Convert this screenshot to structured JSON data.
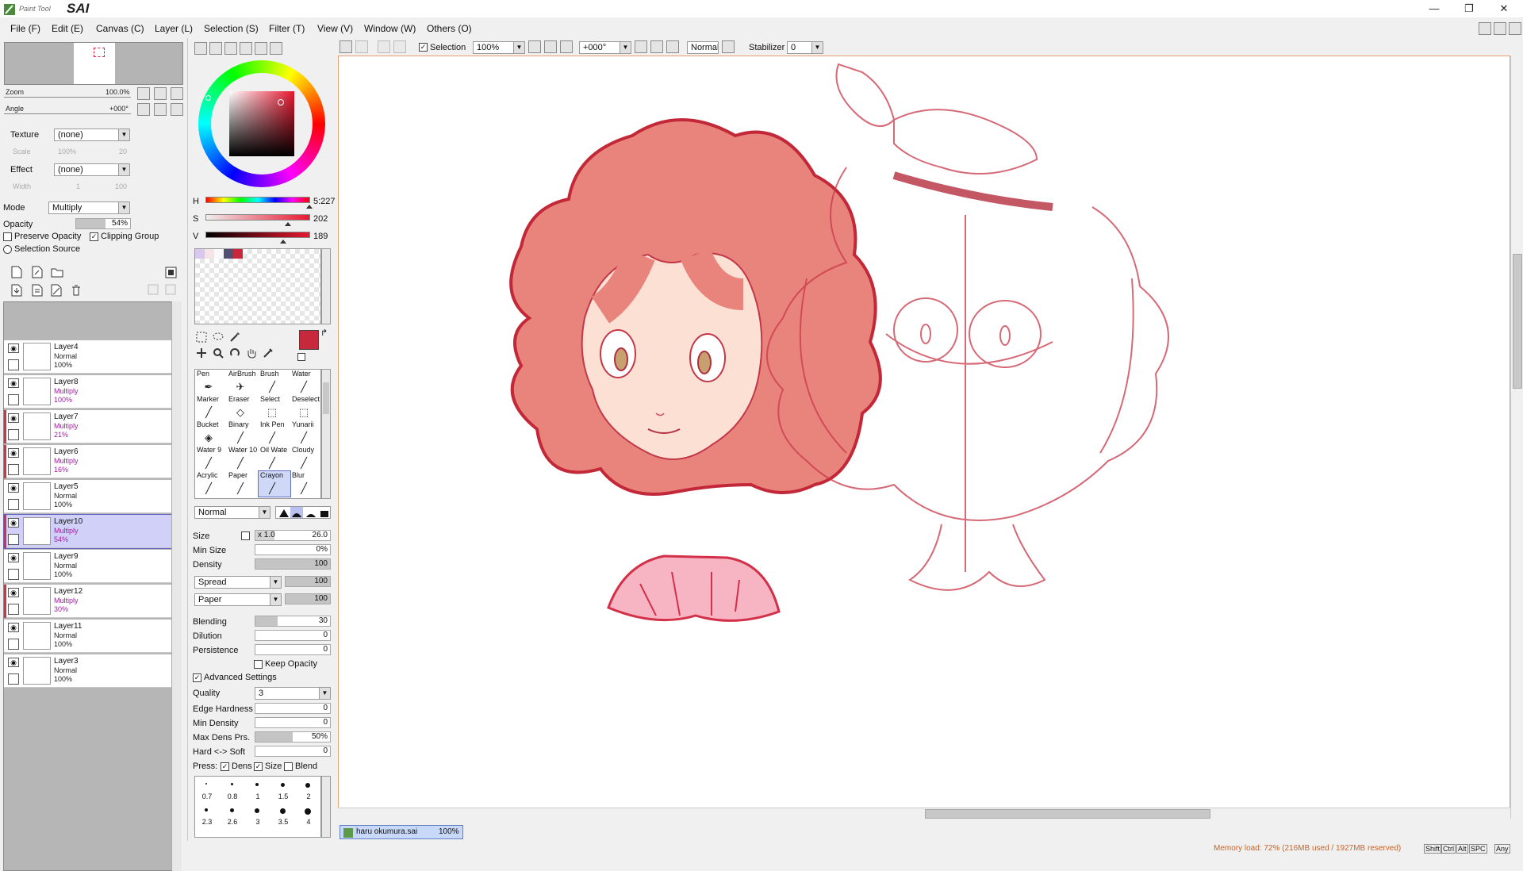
{
  "app": {
    "logo_small": "Paint Tool",
    "logo_big": "SAI"
  },
  "window_buttons": [
    "—",
    "❐",
    "✕"
  ],
  "menu": [
    "File (F)",
    "Edit (E)",
    "Canvas (C)",
    "Layer (L)",
    "Selection (S)",
    "Filter (T)",
    "View (V)",
    "Window (W)",
    "Others (O)"
  ],
  "navigator": {
    "zoom_label": "Zoom",
    "zoom_value": "100.0%",
    "angle_label": "Angle",
    "angle_value": "+000°"
  },
  "layer_props": {
    "texture_label": "Texture",
    "texture_value": "(none)",
    "scale_label": "Scale",
    "scale_value": "100%",
    "scale_num": "20",
    "effect_label": "Effect",
    "effect_value": "(none)",
    "width_label": "Width",
    "width_value": "1",
    "width_num": "100",
    "mode_label": "Mode",
    "mode_value": "Multiply",
    "opacity_label": "Opacity",
    "opacity_value": "54%",
    "opacity_fraction": 0.54,
    "preserve_opacity": "Preserve Opacity",
    "clipping_group": "Clipping Group",
    "selection_source": "Selection Source"
  },
  "layers": [
    {
      "name": "Layer4",
      "mode": "Normal",
      "opacity": "100%",
      "clip": false,
      "selected": false
    },
    {
      "name": "Layer8",
      "mode": "Multiply",
      "opacity": "100%",
      "clip": false,
      "selected": false
    },
    {
      "name": "Layer7",
      "mode": "Multiply",
      "opacity": "21%",
      "clip": true,
      "selected": false
    },
    {
      "name": "Layer6",
      "mode": "Multiply",
      "opacity": "16%",
      "clip": true,
      "selected": false
    },
    {
      "name": "Layer5",
      "mode": "Normal",
      "opacity": "100%",
      "clip": false,
      "selected": false
    },
    {
      "name": "Layer10",
      "mode": "Multiply",
      "opacity": "54%",
      "clip": true,
      "selected": true
    },
    {
      "name": "Layer9",
      "mode": "Normal",
      "opacity": "100%",
      "clip": false,
      "selected": false
    },
    {
      "name": "Layer12",
      "mode": "Multiply",
      "opacity": "30%",
      "clip": true,
      "selected": false
    },
    {
      "name": "Layer11",
      "mode": "Normal",
      "opacity": "100%",
      "clip": false,
      "selected": false
    },
    {
      "name": "Layer3",
      "mode": "Normal",
      "opacity": "100%",
      "clip": false,
      "selected": false
    }
  ],
  "color": {
    "h_label": "H",
    "h_value": "5:227",
    "h_fraction": 0.99,
    "s_label": "S",
    "s_value": "202",
    "s_fraction": 0.79,
    "v_label": "V",
    "v_value": "189",
    "v_fraction": 0.74,
    "primary": "#c8283c",
    "secondary": "#f4b4c0",
    "swatches": [
      "#d8c8f0",
      "#f4e4e8",
      "#f8f8f8",
      "#505070",
      "#c8283c"
    ]
  },
  "tools": [
    {
      "label": "Pen",
      "icon": "✒"
    },
    {
      "label": "AirBrush",
      "icon": "✈"
    },
    {
      "label": "Brush",
      "icon": "╱"
    },
    {
      "label": "Water",
      "icon": "╱"
    },
    {
      "label": "Marker",
      "icon": "╱"
    },
    {
      "label": "Eraser",
      "icon": "◇"
    },
    {
      "label": "Select",
      "icon": "⬚"
    },
    {
      "label": "Deselect",
      "icon": "⬚"
    },
    {
      "label": "Bucket",
      "icon": "◈"
    },
    {
      "label": "Binary",
      "icon": "╱"
    },
    {
      "label": "Ink Pen",
      "icon": "╱"
    },
    {
      "label": "Yunarii",
      "icon": "╱"
    },
    {
      "label": "Water 9",
      "icon": "╱"
    },
    {
      "label": "Water 10",
      "icon": "╱"
    },
    {
      "label": "Oil Wate",
      "icon": "╱"
    },
    {
      "label": "Cloudy",
      "icon": "╱"
    },
    {
      "label": "Acrylic",
      "icon": "╱"
    },
    {
      "label": "Paper",
      "icon": "╱"
    },
    {
      "label": "Crayon",
      "icon": "╱"
    },
    {
      "label": "Blur",
      "icon": "╱"
    }
  ],
  "brush": {
    "blend_mode": "Normal",
    "size_label": "Size",
    "size_mult": "x 1.0",
    "size_value": "26.0",
    "min_size_label": "Min Size",
    "min_size_value": "0%",
    "density_label": "Density",
    "density_value": "100",
    "spread": "Spread",
    "spread_value": "100",
    "paper": "Paper",
    "paper_value": "100",
    "blending_label": "Blending",
    "blending_value": "30",
    "dilution_label": "Dilution",
    "dilution_value": "0",
    "persistence_label": "Persistence",
    "persistence_value": "0",
    "keep_opacity": "Keep Opacity",
    "advanced": "Advanced Settings",
    "quality_label": "Quality",
    "quality_value": "3",
    "edge_hardness_label": "Edge Hardness",
    "edge_hardness_value": "0",
    "min_density_label": "Min Density",
    "min_density_value": "0",
    "max_dens_label": "Max Dens Prs.",
    "max_dens_value": "50%",
    "hard_soft_label": "Hard <-> Soft",
    "hard_soft_value": "0",
    "press_label": "Press:",
    "press_dens": "Dens",
    "press_size": "Size",
    "press_blend": "Blend",
    "size_presets_row1": [
      "0.7",
      "0.8",
      "1",
      "1.5",
      "2"
    ],
    "size_presets_row2": [
      "2.3",
      "2.6",
      "3",
      "3.5",
      "4"
    ]
  },
  "toolbar": {
    "selection_label": "Selection",
    "zoom_value": "100%",
    "angle_value": "+000°",
    "mode_value": "Normal",
    "stabilizer_label": "Stabilizer",
    "stabilizer_value": "0"
  },
  "document_tab": {
    "name": "haru okumura.sai",
    "zoom": "100%"
  },
  "status": {
    "memory": "Memory load: 72% (216MB used / 1927MB reserved)",
    "keys": [
      "Shift",
      "Ctrl",
      "Alt",
      "SPC",
      "Any"
    ]
  }
}
